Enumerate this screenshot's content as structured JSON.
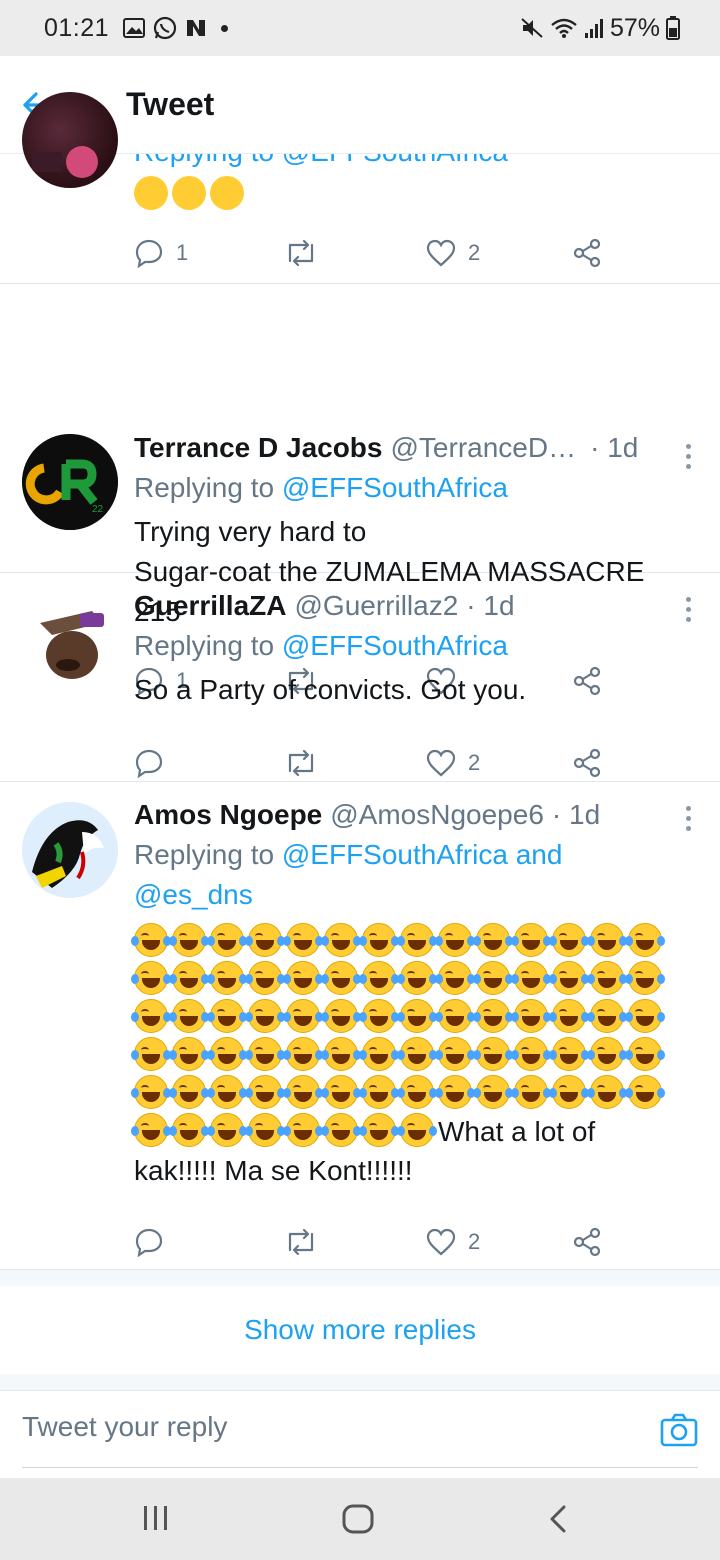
{
  "status_bar": {
    "time": "01:21",
    "battery": "57%",
    "icons_left": [
      "gallery-icon",
      "whatsapp-icon",
      "news-icon"
    ],
    "icons_right": [
      "mute-icon",
      "wifi-icon",
      "signal-icon",
      "battery-icon"
    ]
  },
  "header": {
    "title": "Tweet",
    "back_icon": "arrow-left-icon"
  },
  "tweets": [
    {
      "replying_partial": "Replying to @EFFSouthAfrica",
      "reply_count": "1",
      "like_count": "2"
    },
    {
      "name": "Terrance D Jacobs",
      "handle": "@TerranceD…",
      "time": "· 1d",
      "replying_prefix": "Replying to ",
      "replying_to": "@EFFSouthAfrica",
      "text_line1": "Trying very hard to",
      "text_line2": "Sugar-coat the ZUMALEMA MASSACRE",
      "text_line3": "215",
      "reply_count": "1",
      "like_count": ""
    },
    {
      "name": "GuerrillaZA",
      "handle": "@Guerrillaz2",
      "time": "· 1d",
      "replying_prefix": "Replying to ",
      "replying_to": "@EFFSouthAfrica",
      "text_line1": "So a Party of convicts. Got you.",
      "reply_count": "",
      "like_count": "2"
    },
    {
      "name": "Amos Ngoepe",
      "handle": "@AmosNgoepe6",
      "time": "· 1d",
      "replying_prefix": "Replying to ",
      "replying_to": "@EFFSouthAfrica and",
      "replying_to2": "@es_dns",
      "text_tail": "What a lot of",
      "text_line_last": "kak!!!!! Ma se Kont!!!!!!",
      "reply_count": "",
      "like_count": "2"
    }
  ],
  "show_more": "Show more replies",
  "reply_bar": {
    "placeholder": "Tweet your reply",
    "camera_icon": "camera-icon"
  },
  "colors": {
    "accent": "#1da1f2",
    "muted": "#657786",
    "text": "#14171a"
  }
}
